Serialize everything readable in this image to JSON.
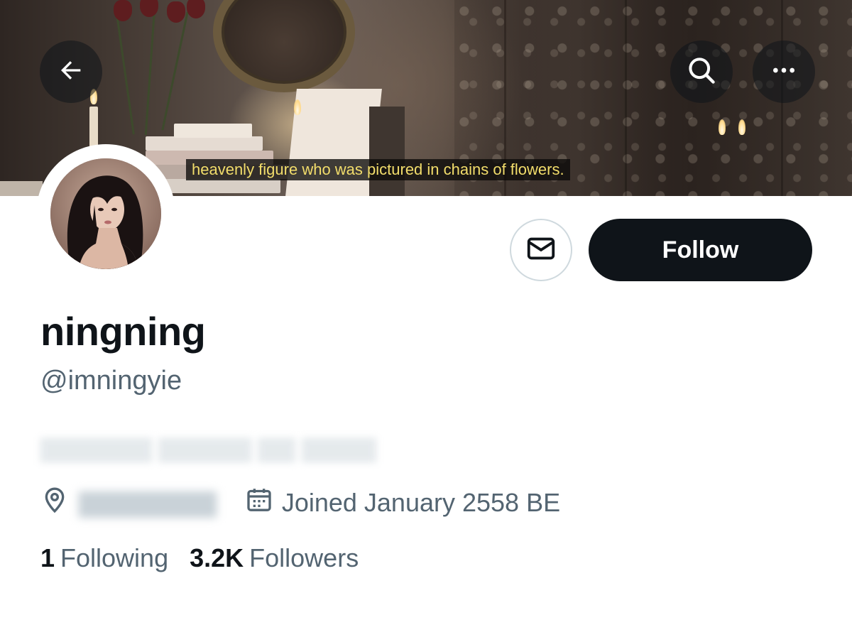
{
  "banner": {
    "caption": "heavenly figure who was pictured in chains of flowers."
  },
  "nav": {
    "back_icon": "arrow-left-icon",
    "search_icon": "search-icon",
    "more_icon": "more-horizontal-icon"
  },
  "actions": {
    "message_icon": "envelope-icon",
    "follow_label": "Follow"
  },
  "profile": {
    "display_name": "ningning",
    "handle": "@imningyie",
    "location_icon": "location-pin-icon",
    "joined_icon": "calendar-icon",
    "joined": "Joined January 2558 BE"
  },
  "stats": {
    "following_count": "1",
    "following_label": "Following",
    "followers_count": "3.2K",
    "followers_label": "Followers"
  },
  "colors": {
    "text_primary": "#0f1419",
    "text_secondary": "#536471",
    "follow_button_bg": "#0f1419",
    "caption_text": "#f2dd6b",
    "border": "#cfd9de"
  }
}
